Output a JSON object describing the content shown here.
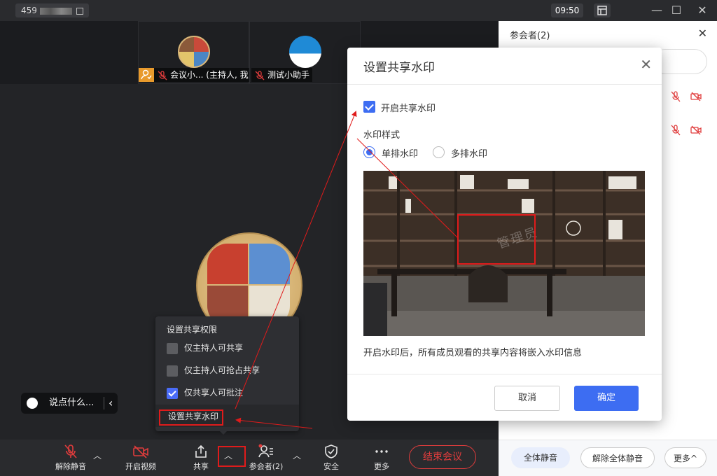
{
  "titlebar": {
    "meeting_id": "459",
    "clock": "09:50"
  },
  "tiles": [
    {
      "name": "会议小... (主持人, 我)"
    },
    {
      "name": "测试小助手"
    }
  ],
  "chat": {
    "placeholder": "说点什么..."
  },
  "share_menu": {
    "header": "设置共享权限",
    "options": [
      {
        "label": "仅主持人可共享",
        "checked": false
      },
      {
        "label": "仅主持人可抢占共享",
        "checked": false
      },
      {
        "label": "仅共享人可批注",
        "checked": true
      }
    ],
    "watermark_item": "设置共享水印"
  },
  "toolbar": {
    "unmute": "解除静音",
    "video": "开启视频",
    "share": "共享",
    "participants": "参会者(2)",
    "security": "安全",
    "more": "更多",
    "end": "结束会议"
  },
  "panel": {
    "title": "参会者(2)",
    "mute_all": "全体静音",
    "unmute_all": "解除全体静音",
    "more": "更多"
  },
  "dialog": {
    "title": "设置共享水印",
    "enable_label": "开启共享水印",
    "enable_checked": true,
    "style_label": "水印样式",
    "style_single": "单排水印",
    "style_multi": "多排水印",
    "style_selected": "single",
    "preview_watermark": "管理员",
    "note": "开启水印后，所有成员观看的共享内容将嵌入水印信息",
    "cancel": "取消",
    "ok": "确定"
  },
  "colors": {
    "accent": "#3d6df2",
    "danger": "#e03c3c",
    "annotation": "#e01b1b",
    "host_badge": "#e89a2c"
  }
}
